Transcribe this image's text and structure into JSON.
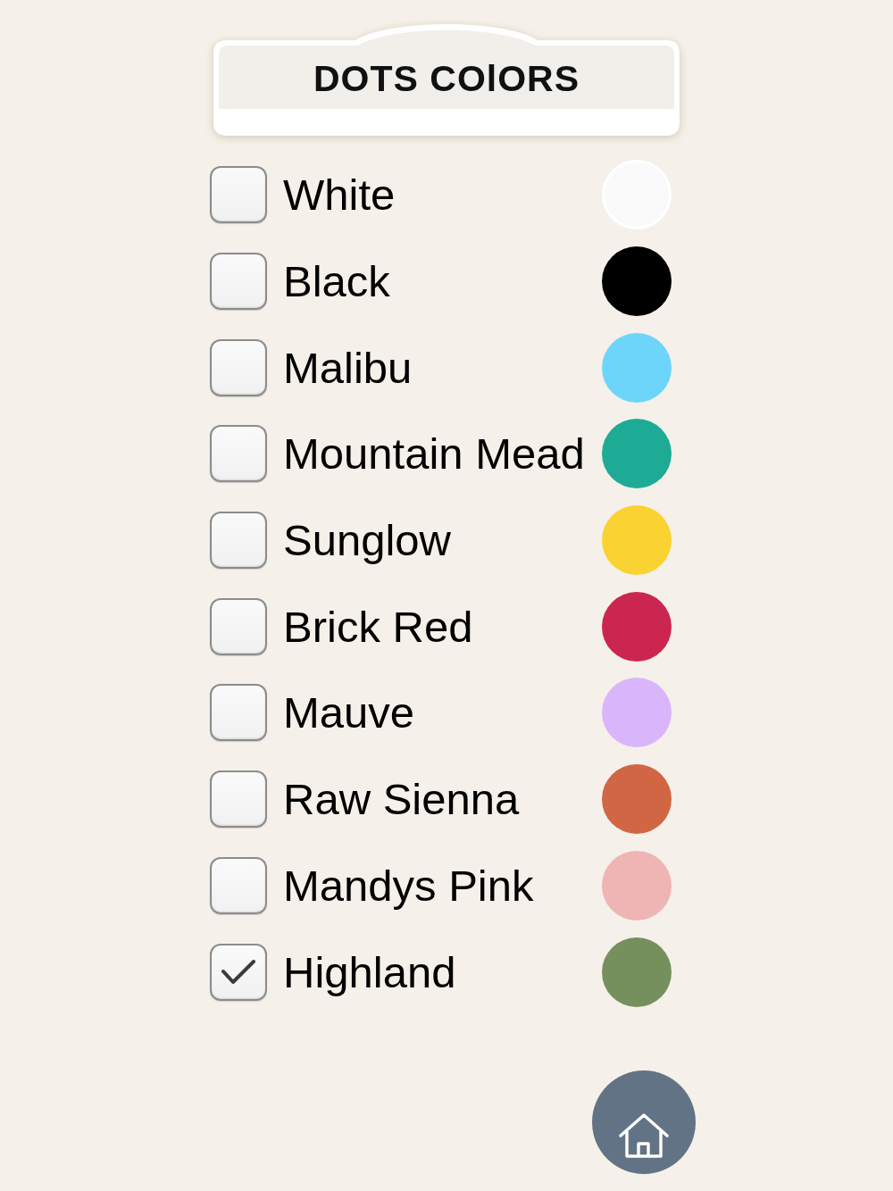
{
  "header": {
    "title": "DOTS COlORS"
  },
  "colors": [
    {
      "name": "White",
      "checked": false,
      "color": "#fafafa"
    },
    {
      "name": "Black",
      "checked": false,
      "color": "#000000"
    },
    {
      "name": "Malibu",
      "checked": false,
      "color": "#6dd5fa"
    },
    {
      "name": "Mountain Mead",
      "checked": false,
      "color": "#1eab96"
    },
    {
      "name": "Sunglow",
      "checked": false,
      "color": "#fad232"
    },
    {
      "name": "Brick Red",
      "checked": false,
      "color": "#cb2650"
    },
    {
      "name": "Mauve",
      "checked": false,
      "color": "#d9b6fb"
    },
    {
      "name": "Raw Sienna",
      "checked": false,
      "color": "#d06643"
    },
    {
      "name": "Mandys Pink",
      "checked": false,
      "color": "#efb4b4"
    },
    {
      "name": "Highland",
      "checked": true,
      "color": "#76905d"
    }
  ]
}
